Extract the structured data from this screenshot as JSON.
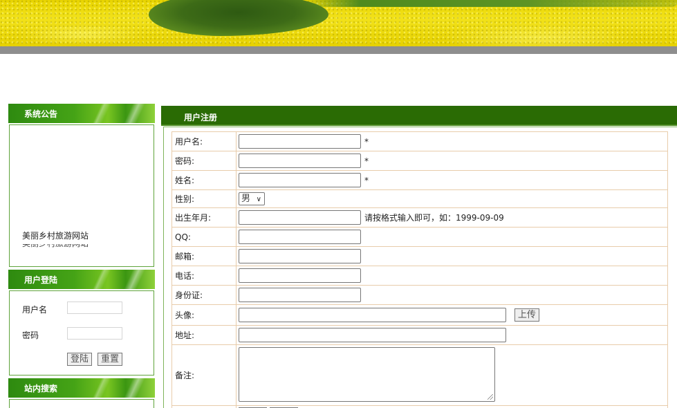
{
  "sidebar": {
    "notice": {
      "title": "系统公告",
      "text": "美丽乡村旅游网站"
    },
    "login": {
      "title": "用户登陆",
      "username_label": "用户名",
      "password_label": "密码",
      "login_button": "登陆",
      "reset_button": "重置"
    },
    "search": {
      "title": "站内搜索"
    }
  },
  "register": {
    "title": "用户注册",
    "fields": {
      "username": {
        "label": "用户名:",
        "note": "*"
      },
      "password": {
        "label": "密码:",
        "note": "*"
      },
      "realname": {
        "label": "姓名:",
        "note": "*"
      },
      "gender": {
        "label": "性别:",
        "selected": "男"
      },
      "birth": {
        "label": "出生年月:",
        "note": "请按格式输入即可，如：1999-09-09"
      },
      "qq": {
        "label": "QQ:"
      },
      "email": {
        "label": "邮箱:"
      },
      "phone": {
        "label": "电话:"
      },
      "idcard": {
        "label": "身份证:"
      },
      "avatar": {
        "label": "头像:",
        "upload_button": "上传"
      },
      "address": {
        "label": "地址:"
      },
      "remark": {
        "label": "备注:"
      }
    }
  }
}
